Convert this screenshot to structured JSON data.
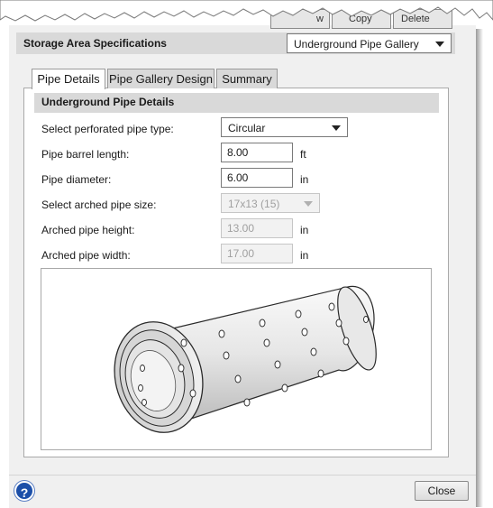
{
  "toolbar": {
    "partial_button_1": "w",
    "partial_button_2": "Copy",
    "partial_button_3": "Delete"
  },
  "storage": {
    "title": "Storage Area Specifications",
    "type_value": "Underground Pipe Gallery"
  },
  "tabs": [
    {
      "label": "Pipe Details",
      "active": true
    },
    {
      "label": "Pipe Gallery Design",
      "active": false
    },
    {
      "label": "Summary",
      "active": false
    }
  ],
  "details": {
    "header": "Underground Pipe Details",
    "pipe_type_label": "Select perforated pipe type:",
    "pipe_type_value": "Circular",
    "barrel_length_label": "Pipe barrel length:",
    "barrel_length_value": "8.00",
    "barrel_length_unit": "ft",
    "diameter_label": "Pipe diameter:",
    "diameter_value": "6.00",
    "diameter_unit": "in",
    "arched_size_label": "Select arched pipe size:",
    "arched_size_value": "17x13 (15)",
    "arched_height_label": "Arched pipe height:",
    "arched_height_value": "13.00",
    "arched_height_unit": "in",
    "arched_width_label": "Arched pipe width:",
    "arched_width_value": "17.00",
    "arched_width_unit": "in"
  },
  "footer": {
    "help_symbol": "?",
    "close_label": "Close"
  },
  "colors": {
    "panel_bg": "#f0f0f0",
    "header_bg": "#d9d9d9",
    "help_blue": "#1c4fa8"
  }
}
